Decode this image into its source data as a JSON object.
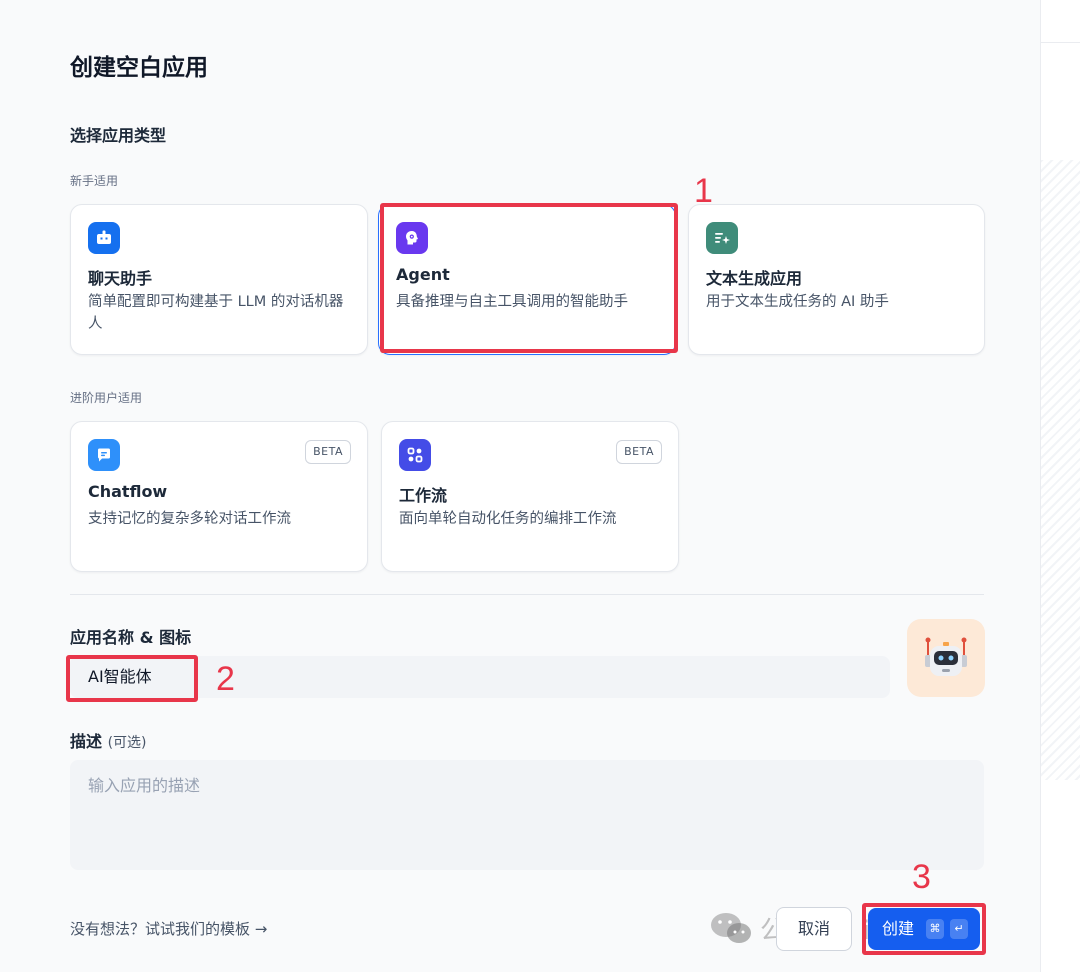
{
  "dialog": {
    "title": "创建空白应用",
    "section_title": "选择应用类型",
    "group_beginner": "新手适用",
    "group_advanced": "进阶用户适用"
  },
  "app_types": [
    {
      "title": "聊天助手",
      "desc": "简单配置即可构建基于 LLM 的对话机器人",
      "icon": "chat-bot-icon",
      "color": "#1570ef",
      "selected": false
    },
    {
      "title": "Agent",
      "desc": "具备推理与自主工具调用的智能助手",
      "icon": "agent-brain-icon",
      "color": "#6938ef",
      "selected": true
    },
    {
      "title": "文本生成应用",
      "desc": "用于文本生成任务的 AI 助手",
      "icon": "text-generate-icon",
      "color": "#3f8c7a",
      "selected": false
    },
    {
      "title": "Chatflow",
      "desc": "支持记忆的复杂多轮对话工作流",
      "icon": "chatflow-icon",
      "color": "#2e90fa",
      "badge": "BETA",
      "selected": false
    },
    {
      "title": "工作流",
      "desc": "面向单轮自动化任务的编排工作流",
      "icon": "workflow-icon",
      "color": "#444ce7",
      "badge": "BETA",
      "selected": false
    }
  ],
  "form": {
    "name_label": "应用名称 & 图标",
    "name_value": "AI智能体",
    "avatar_icon": "robot-avatar-icon",
    "desc_label": "描述",
    "desc_optional": "(可选)",
    "desc_placeholder": "输入应用的描述"
  },
  "footer": {
    "template_link": "没有想法？试试我们的模板 →",
    "cancel": "取消",
    "create": "创建",
    "shortcut_cmd": "⌘",
    "shortcut_enter": "↵"
  },
  "annotations": [
    "1",
    "2",
    "3"
  ],
  "watermark": "公众号 · izhouhui",
  "colors": {
    "primary": "#155eef",
    "annotation": "#e8364a",
    "avatar_bg": "#fde9d7"
  }
}
